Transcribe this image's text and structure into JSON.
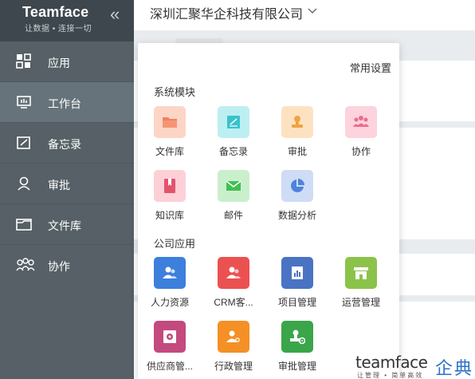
{
  "brand": {
    "name": "Teamface",
    "slogan": "让数据 • 连接一切"
  },
  "sidebar": {
    "items": [
      {
        "label": "应用",
        "icon": "apps-grid-icon"
      },
      {
        "label": "工作台",
        "icon": "workbench-icon"
      },
      {
        "label": "备忘录",
        "icon": "memo-icon"
      },
      {
        "label": "审批",
        "icon": "approval-user-icon"
      },
      {
        "label": "文件库",
        "icon": "folder-icon"
      },
      {
        "label": "协作",
        "icon": "team-icon"
      }
    ]
  },
  "header": {
    "company": "深圳汇聚华企科技有限公司"
  },
  "panel": {
    "common_settings": "常用设置",
    "system_title": "系统模块",
    "company_title": "公司应用",
    "system_apps": [
      {
        "label": "文件库",
        "icon": "folder-icon",
        "bg": "#fdd5c7",
        "fg": "#f1825e"
      },
      {
        "label": "备忘录",
        "icon": "memo-icon",
        "bg": "#bdeff2",
        "fg": "#37c3cc"
      },
      {
        "label": "审批",
        "icon": "stamp-icon",
        "bg": "#fde2c2",
        "fg": "#f0a443"
      },
      {
        "label": "协作",
        "icon": "team-icon",
        "bg": "#fdd3dd",
        "fg": "#ea6d8a"
      },
      {
        "label": "知识库",
        "icon": "book-icon",
        "bg": "#fdd0d8",
        "fg": "#e2546e"
      },
      {
        "label": "邮件",
        "icon": "mail-icon",
        "bg": "#c9efcd",
        "fg": "#41bf52"
      },
      {
        "label": "数据分析",
        "icon": "pie-chart-icon",
        "bg": "#cfdcf6",
        "fg": "#4f82dc"
      }
    ],
    "company_apps": [
      {
        "label": "人力资源",
        "icon": "people-icon",
        "bg": "#3c7fdd"
      },
      {
        "label": "CRM客...",
        "icon": "people-icon",
        "bg": "#eb5150"
      },
      {
        "label": "项目管理",
        "icon": "report-icon",
        "bg": "#4a73c4"
      },
      {
        "label": "运营管理",
        "icon": "store-icon",
        "bg": "#8bc34a"
      },
      {
        "label": "供应商管...",
        "icon": "supplier-icon",
        "bg": "#c4497e"
      },
      {
        "label": "行政管理",
        "icon": "admin-icon",
        "bg": "#f49025"
      },
      {
        "label": "审批管理",
        "icon": "approval-gear-icon",
        "bg": "#3ba54a"
      }
    ]
  },
  "watermark": {
    "en": "teamface",
    "sub": "让管理 • 简单高效",
    "cn": "企典"
  }
}
